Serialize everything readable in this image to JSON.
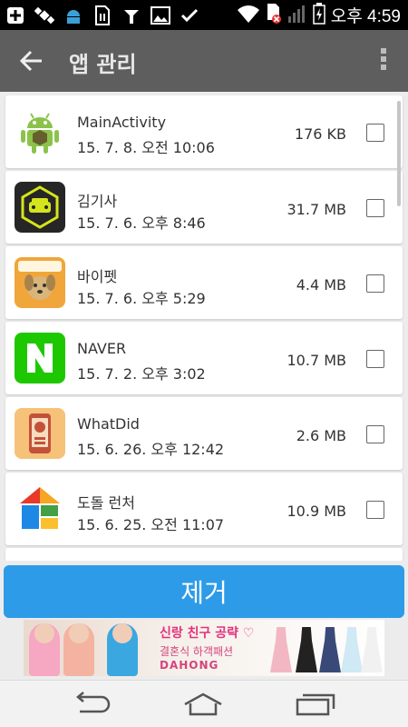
{
  "status_bar": {
    "time_label": "오후 4:59",
    "icons": [
      "plus-icon",
      "satellite-icon",
      "android-icon",
      "sim-icon",
      "usb-icon",
      "image-icon",
      "check-icon",
      "wifi-icon",
      "sim-error-icon",
      "signal-icon",
      "battery-icon"
    ]
  },
  "app_bar": {
    "title": "앱 관리",
    "back_icon": "arrow-left-icon",
    "menu_icon": "more-vert-icon"
  },
  "apps": [
    {
      "name": "MainActivity",
      "date": "15. 7. 8. 오전 10:06",
      "size": "176 KB",
      "icon": "android-robot-icon"
    },
    {
      "name": "김기사",
      "date": "15. 7. 6. 오후 8:46",
      "size": "31.7 MB",
      "icon": "kimgisa-car-icon"
    },
    {
      "name": "바이펫",
      "date": "15. 7. 6. 오후 5:29",
      "size": "4.4 MB",
      "icon": "bypet-dog-icon"
    },
    {
      "name": "NAVER",
      "date": "15. 7. 2. 오후 3:02",
      "size": "10.7 MB",
      "icon": "naver-n-icon"
    },
    {
      "name": "WhatDid",
      "date": "15. 6. 26. 오후 12:42",
      "size": "2.6 MB",
      "icon": "whatdid-phone-icon"
    },
    {
      "name": "도돌 런처",
      "date": "15. 6. 25. 오전 11:07",
      "size": "10.9 MB",
      "icon": "dodol-launcher-icon"
    }
  ],
  "remove_button_label": "제거",
  "ad": {
    "line1": "신랑 친구 공략 ♡",
    "line2": "결혼식 하객패션",
    "line3": "DAHONG"
  },
  "colors": {
    "app_bar": "#5e5e5e",
    "remove_button": "#2d9be8",
    "naver_green": "#1ec800",
    "ad_pink": "#e2337c"
  }
}
